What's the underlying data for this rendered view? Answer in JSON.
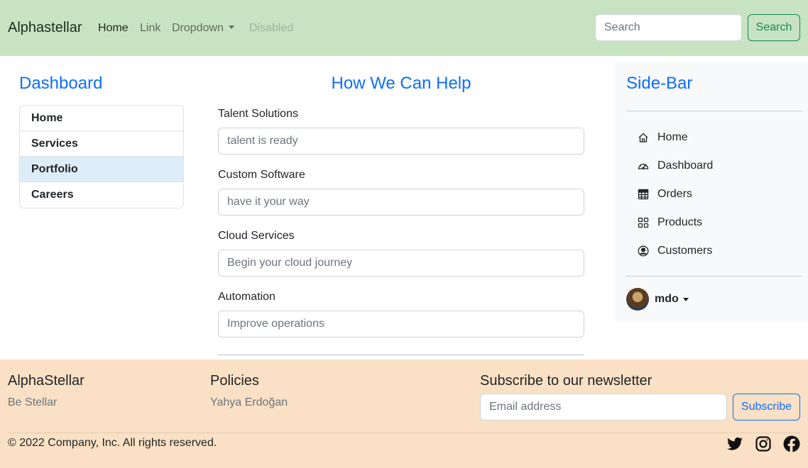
{
  "navbar": {
    "brand": "Alphastellar",
    "links": [
      {
        "label": "Home",
        "state": "active"
      },
      {
        "label": "Link",
        "state": "normal"
      },
      {
        "label": "Dropdown",
        "state": "normal"
      },
      {
        "label": "Disabled",
        "state": "disabled"
      }
    ],
    "search_placeholder": "Search",
    "search_button": "Search"
  },
  "dashboard": {
    "title": "Dashboard",
    "items": [
      {
        "label": "Home",
        "highlighted": false
      },
      {
        "label": "Services",
        "highlighted": false
      },
      {
        "label": "Portfolio",
        "highlighted": true
      },
      {
        "label": "Careers",
        "highlighted": false
      }
    ]
  },
  "help": {
    "title": "How We Can Help",
    "fields": [
      {
        "label": "Talent Solutions",
        "placeholder": "talent is ready"
      },
      {
        "label": "Custom Software",
        "placeholder": "have it your way"
      },
      {
        "label": "Cloud Services",
        "placeholder": "Begin your cloud journey"
      },
      {
        "label": "Automation",
        "placeholder": "Improve operations"
      }
    ]
  },
  "sidebar": {
    "title": "Side-Bar",
    "items": [
      {
        "label": "Home",
        "icon": "house-icon"
      },
      {
        "label": "Dashboard",
        "icon": "speedometer-icon"
      },
      {
        "label": "Orders",
        "icon": "table-icon"
      },
      {
        "label": "Products",
        "icon": "grid-icon"
      },
      {
        "label": "Customers",
        "icon": "person-circle-icon"
      }
    ],
    "user": "mdo"
  },
  "footer": {
    "col1": {
      "heading": "AlphaStellar",
      "text": "Be Stellar"
    },
    "col2": {
      "heading": "Policies",
      "text": "Yahya Erdoğan"
    },
    "newsletter": {
      "heading": "Subscribe to our newsletter",
      "email_placeholder": "Email address",
      "button": "Subscribe"
    },
    "copyright": "© 2022 Company, Inc. All rights reserved.",
    "social": [
      "twitter-icon",
      "instagram-icon",
      "facebook-icon"
    ]
  },
  "colors": {
    "navbar_bg": "#c8e3c2",
    "footer_bg": "#fae0c4",
    "primary": "#0d6efd",
    "success": "#198754",
    "sidebar_bg": "#f8f9fa"
  }
}
